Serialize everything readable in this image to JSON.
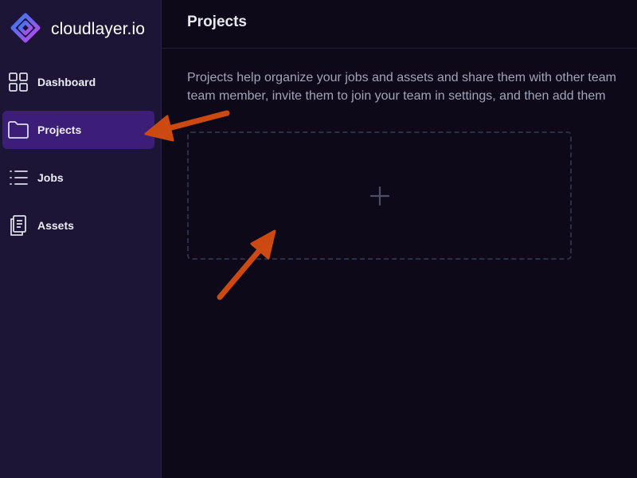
{
  "brand": {
    "name": "cloudlayer.io",
    "logo_icon": "cloudlayer-logo-icon"
  },
  "sidebar": {
    "items": [
      {
        "label": "Dashboard",
        "icon": "grid-icon",
        "active": false
      },
      {
        "label": "Projects",
        "icon": "folder-icon",
        "active": true
      },
      {
        "label": "Jobs",
        "icon": "list-icon",
        "active": false
      },
      {
        "label": "Assets",
        "icon": "document-icon",
        "active": false
      }
    ]
  },
  "main": {
    "title": "Projects",
    "description_line1": "Projects help organize your jobs and assets and share them with other team",
    "description_line2": "team member, invite them to join your team in settings, and then add them",
    "add_card": {
      "icon": "plus-icon"
    }
  },
  "colors": {
    "sidebar_bg": "#1c1535",
    "main_bg": "#0d0919",
    "active_item_bg": "#3c1d78",
    "annotation_arrow": "#cc4a12",
    "logo_gradient_start": "#2f7cf6",
    "logo_gradient_end": "#c046e8"
  }
}
